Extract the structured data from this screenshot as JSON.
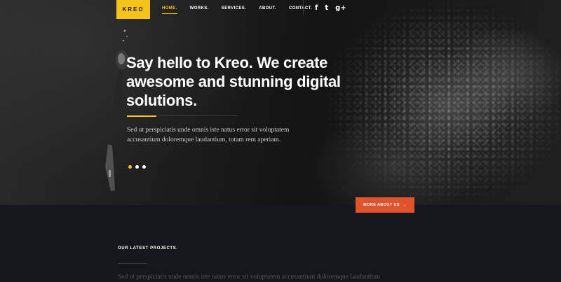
{
  "brand": {
    "logo_text": "KREO",
    "accent_color": "#f5c31a"
  },
  "nav": {
    "items": [
      {
        "label": "HOME.",
        "active": true
      },
      {
        "label": "WORKS.",
        "active": false
      },
      {
        "label": "SERVICES.",
        "active": false
      },
      {
        "label": "ABOUT.",
        "active": false
      },
      {
        "label": "CONTACT.",
        "active": false
      }
    ],
    "social": [
      {
        "icon": "facebook-icon",
        "glyph": "f"
      },
      {
        "icon": "twitter-icon",
        "glyph": "t"
      },
      {
        "icon": "google-plus-icon",
        "glyph": "g+"
      }
    ]
  },
  "hero": {
    "headline": "Say hello to Kreo. We create awesome and stunning digital solutions.",
    "subtext": "Sed ut perspiciatis unde omnis iste natus error sit voluptatem accusantium doloremque laudantium, totam rem aperiam.",
    "slider": {
      "count": 3,
      "active_index": 0
    }
  },
  "cta": {
    "label": "MORE ABOUT US",
    "arrow": "→",
    "color": "#e0542d"
  },
  "projects": {
    "title": "OUR LATEST PROJECTS",
    "title_dot": ".",
    "text": "Sed ut perspiciatis unde omnis iste natus error sit voluptatem accusantium doloremque laudantium"
  }
}
